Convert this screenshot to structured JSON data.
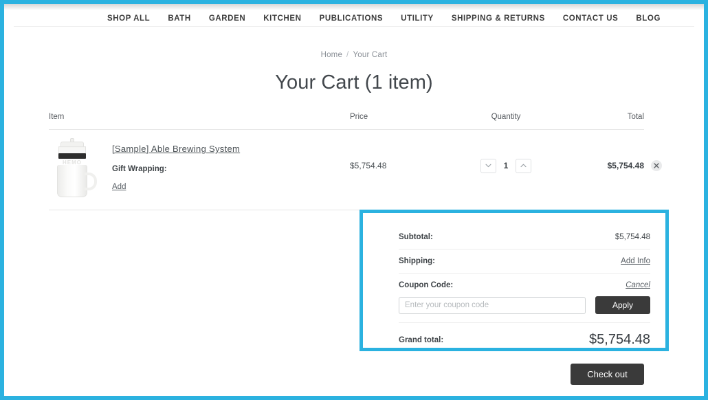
{
  "theme": {
    "highlight": "#2bb2e0",
    "dark_button": "#3a3a3a",
    "text": "#3f4448",
    "muted": "#8a8f96",
    "rule": "#e6e6e6"
  },
  "nav": {
    "items": [
      {
        "label": "SHOP ALL"
      },
      {
        "label": "BATH"
      },
      {
        "label": "GARDEN"
      },
      {
        "label": "KITCHEN"
      },
      {
        "label": "PUBLICATIONS"
      },
      {
        "label": "UTILITY"
      },
      {
        "label": "SHIPPING & RETURNS"
      },
      {
        "label": "CONTACT US"
      },
      {
        "label": "BLOG"
      }
    ]
  },
  "breadcrumb": {
    "home": "Home",
    "separator": "/",
    "current": "Your Cart"
  },
  "page_title": "Your Cart (1 item)",
  "cart": {
    "headers": {
      "item": "Item",
      "price": "Price",
      "quantity": "Quantity",
      "total": "Total"
    },
    "rows": [
      {
        "name": "[Sample] Able Brewing System",
        "thumb_brand": "HEMO",
        "option_label": "Gift Wrapping:",
        "option_action": "Add",
        "price": "$5,754.48",
        "quantity": "1",
        "total": "$5,754.48",
        "remove_icon": "close-icon",
        "qty_decrement_icon": "chevron-down-icon",
        "qty_increment_icon": "chevron-up-icon"
      }
    ]
  },
  "summary": {
    "subtotal_label": "Subtotal:",
    "subtotal_value": "$5,754.48",
    "shipping_label": "Shipping:",
    "shipping_action": "Add Info",
    "coupon_label": "Coupon Code:",
    "coupon_cancel": "Cancel",
    "coupon_placeholder": "Enter your coupon code",
    "coupon_value": "",
    "apply_label": "Apply",
    "grand_total_label": "Grand total:",
    "grand_total_value": "$5,754.48"
  },
  "checkout": {
    "label": "Check out"
  }
}
